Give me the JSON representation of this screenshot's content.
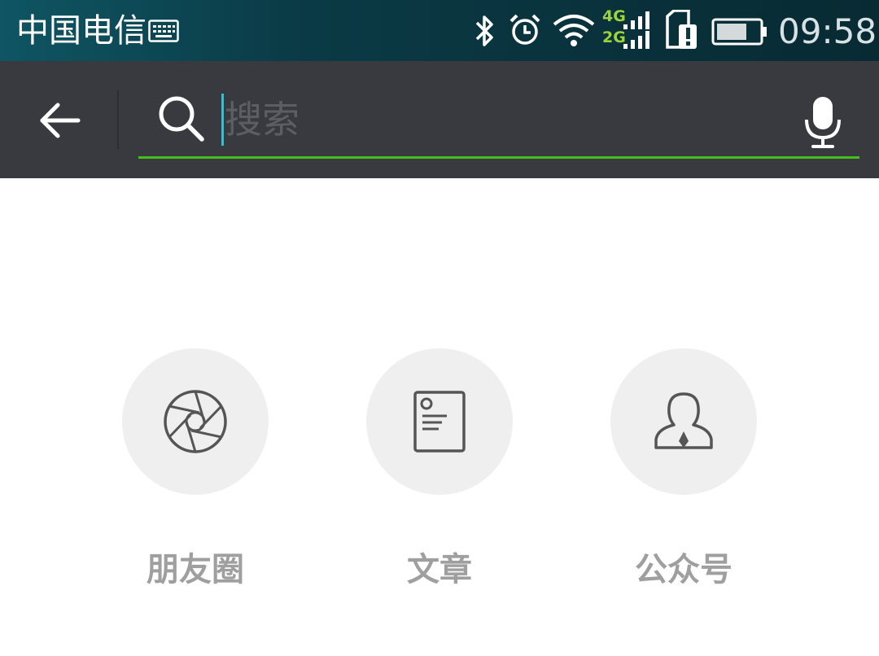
{
  "status_bar": {
    "carrier": "中国电信",
    "network_top": "4G",
    "network_bottom": "2G",
    "time": "09:58",
    "icons": [
      "keyboard-icon",
      "bluetooth-icon",
      "alarm-icon",
      "wifi-icon",
      "signal-icon",
      "sim-alert-icon",
      "battery-icon"
    ]
  },
  "search": {
    "placeholder": "搜索",
    "value": "",
    "icons": [
      "back-arrow-icon",
      "search-icon",
      "microphone-icon"
    ],
    "accent_color": "#45c01a"
  },
  "categories": [
    {
      "label": "朋友圈",
      "icon": "camera-shutter-icon"
    },
    {
      "label": "文章",
      "icon": "document-icon"
    },
    {
      "label": "公众号",
      "icon": "person-tie-icon"
    }
  ],
  "colors": {
    "toolbar_background": "#393a3f",
    "category_circle": "#efefef",
    "category_label": "#9f9f9f"
  }
}
